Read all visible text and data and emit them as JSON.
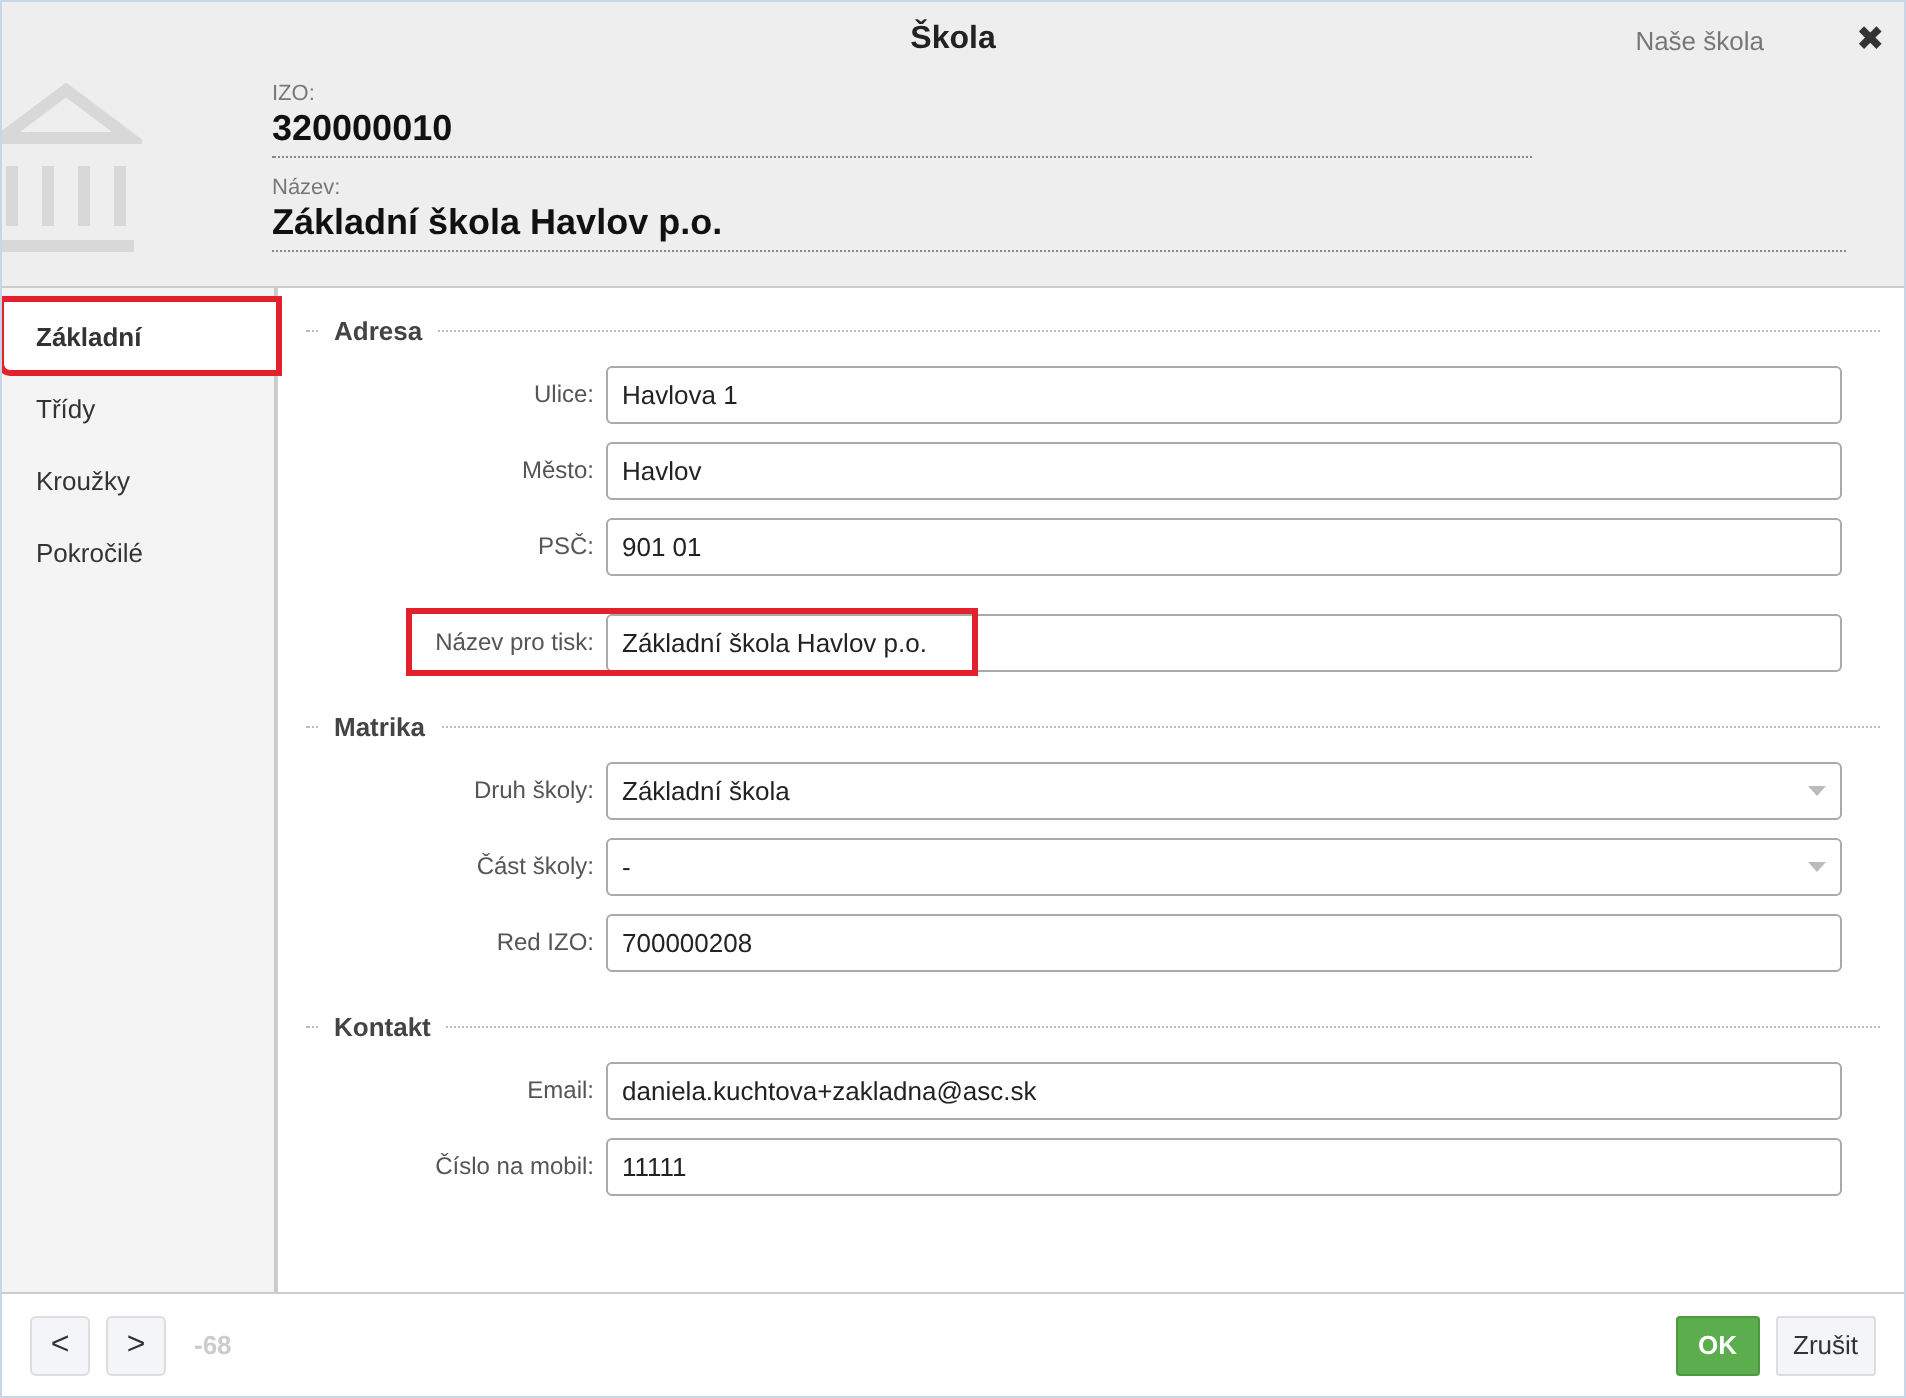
{
  "window": {
    "title": "Škola",
    "context": "Naše škola",
    "close": "✖"
  },
  "header": {
    "fields": [
      {
        "label": "IZO:",
        "value": "320000010"
      },
      {
        "label": "Název:",
        "value": "Základní škola Havlov p.o."
      }
    ]
  },
  "sidebar": {
    "items": [
      {
        "label": "Základní",
        "selected": true,
        "highlighted": true
      },
      {
        "label": "Třídy",
        "selected": false,
        "highlighted": false
      },
      {
        "label": "Kroužky",
        "selected": false,
        "highlighted": false
      },
      {
        "label": "Pokročilé",
        "selected": false,
        "highlighted": false
      }
    ]
  },
  "sections": [
    {
      "title": "Adresa",
      "fields": [
        {
          "kind": "text",
          "label": "Ulice:",
          "value": "Havlova 1",
          "highlighted": false
        },
        {
          "kind": "text",
          "label": "Město:",
          "value": "Havlov",
          "highlighted": false
        },
        {
          "kind": "text",
          "label": "PSČ:",
          "value": "901 01",
          "highlighted": false
        },
        {
          "kind": "text",
          "label": "Název pro tisk:",
          "value": "Základní škola Havlov p.o.",
          "highlighted": true
        }
      ]
    },
    {
      "title": "Matrika",
      "fields": [
        {
          "kind": "select",
          "label": "Druh školy:",
          "value": "Základní škola",
          "highlighted": false
        },
        {
          "kind": "select",
          "label": "Část školy:",
          "value": "-",
          "highlighted": false
        },
        {
          "kind": "text",
          "label": "Red IZO:",
          "value": "700000208",
          "highlighted": false
        }
      ]
    },
    {
      "title": "Kontakt",
      "fields": [
        {
          "kind": "text",
          "label": "Email:",
          "value": "daniela.kuchtova+zakladna@asc.sk",
          "highlighted": false
        },
        {
          "kind": "text",
          "label": "Číslo na mobil:",
          "value": "11111",
          "highlighted": false
        }
      ]
    }
  ],
  "footer": {
    "prev": "<",
    "next": ">",
    "counter": "-68",
    "ok": "OK",
    "cancel": "Zrušit"
  }
}
